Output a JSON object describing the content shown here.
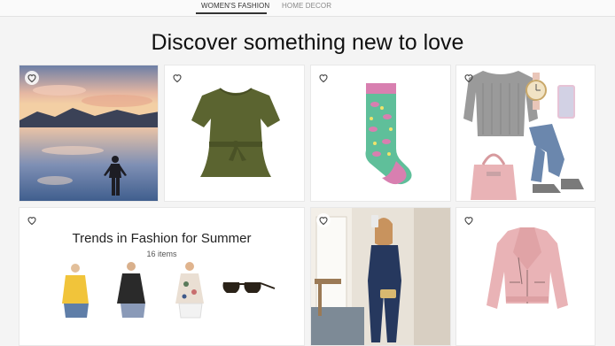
{
  "nav": {
    "items": [
      {
        "label": "WOMEN'S FASHION",
        "active": true
      },
      {
        "label": "HOME DECOR",
        "active": false
      }
    ]
  },
  "headline": "Discover something new to love",
  "cards": [
    {
      "name": "lake-sunset-photo",
      "icon": "heart-icon"
    },
    {
      "name": "olive-peplum-top",
      "icon": "heart-icon"
    },
    {
      "name": "novelty-socks",
      "icon": "heart-icon"
    },
    {
      "name": "gray-sweater-outfit",
      "icon": "heart-icon"
    },
    {
      "name": "trends-collection",
      "icon": "heart-icon"
    },
    {
      "name": "navy-jumpsuit-photo",
      "icon": "heart-icon"
    },
    {
      "name": "pink-moto-jacket",
      "icon": "heart-icon"
    }
  ],
  "trends": {
    "title": "Trends in Fashion for Summer",
    "count": "16 items"
  },
  "colors": {
    "olive": "#5b6430",
    "sock_teal": "#5fbf9a",
    "sock_pink": "#d87fb0",
    "sweater_gray": "#9a9a9a",
    "denim": "#6b87ad",
    "blush_pink": "#e9b3b6"
  }
}
